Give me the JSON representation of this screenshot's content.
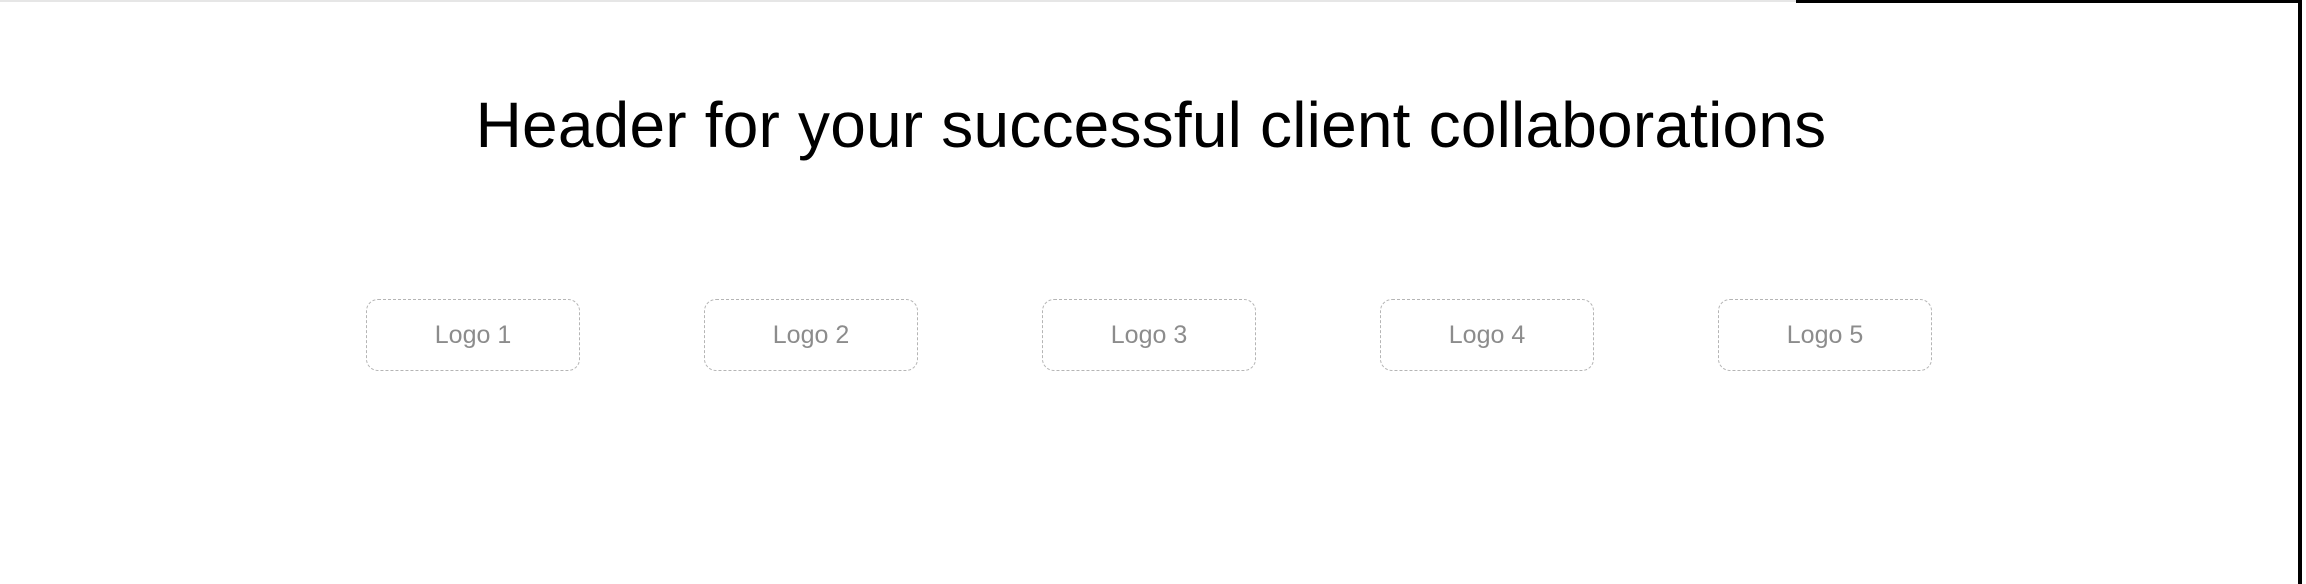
{
  "header": {
    "title": "Header for your successful client collaborations"
  },
  "logos": [
    {
      "label": "Logo 1"
    },
    {
      "label": "Logo 2"
    },
    {
      "label": "Logo 3"
    },
    {
      "label": "Logo 4"
    },
    {
      "label": "Logo 5"
    }
  ]
}
